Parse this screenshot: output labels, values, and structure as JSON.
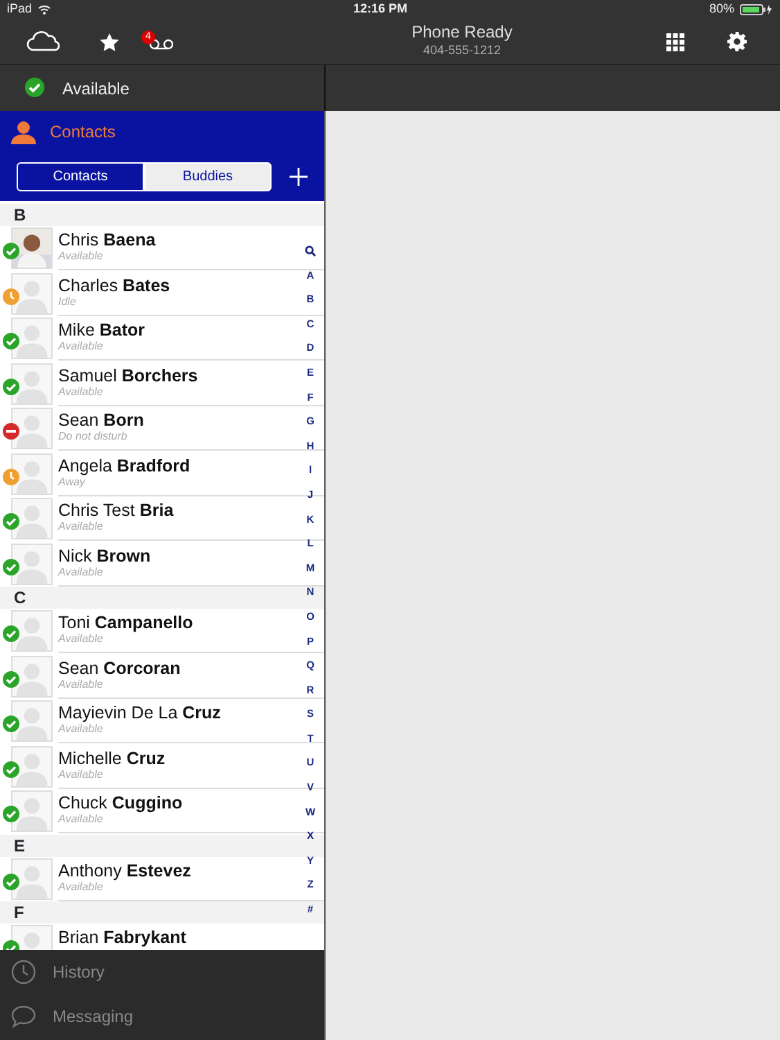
{
  "status_bar": {
    "carrier": "iPad",
    "time": "12:16 PM",
    "battery": "80%"
  },
  "toolbar": {
    "title": "Phone Ready",
    "number": "404-555-1212",
    "voicemail_badge": "4"
  },
  "presence": {
    "label": "Available",
    "kind": "available"
  },
  "contacts_header": {
    "title": "Contacts"
  },
  "segments": [
    {
      "label": "Contacts",
      "selected": true
    },
    {
      "label": "Buddies",
      "selected": false
    }
  ],
  "sections": [
    {
      "letter": "B",
      "contacts": [
        {
          "name": "Chris **Baena**",
          "status_text": "Available",
          "kind": "available",
          "has_photo": true
        },
        {
          "name": "Charles **Bates**",
          "status_text": "Idle",
          "kind": "away",
          "has_photo": false
        },
        {
          "name": "Mike **Bator**",
          "status_text": "Available",
          "kind": "available",
          "has_photo": false
        },
        {
          "name": "Samuel **Borchers**",
          "status_text": "Available",
          "kind": "available",
          "has_photo": false
        },
        {
          "name": "Sean **Born**",
          "status_text": "Do not disturb",
          "kind": "dnd",
          "has_photo": false
        },
        {
          "name": "Angela **Bradford**",
          "status_text": "Away",
          "kind": "away",
          "has_photo": false
        },
        {
          "name": "Chris Test **Bria**",
          "status_text": "Available",
          "kind": "available",
          "has_photo": false
        },
        {
          "name": "Nick **Brown**",
          "status_text": "Available",
          "kind": "available",
          "has_photo": false
        }
      ]
    },
    {
      "letter": "C",
      "contacts": [
        {
          "name": "Toni **Campanello**",
          "status_text": "Available",
          "kind": "available",
          "has_photo": false
        },
        {
          "name": "Sean **Corcoran**",
          "status_text": "Available",
          "kind": "available",
          "has_photo": false
        },
        {
          "name": "Mayievin De La **Cruz**",
          "status_text": "Available",
          "kind": "available",
          "has_photo": false
        },
        {
          "name": "Michelle **Cruz**",
          "status_text": "Available",
          "kind": "available",
          "has_photo": false
        },
        {
          "name": "Chuck **Cuggino**",
          "status_text": "Available",
          "kind": "available",
          "has_photo": false
        }
      ]
    },
    {
      "letter": "E",
      "contacts": [
        {
          "name": "Anthony **Estevez**",
          "status_text": "Available",
          "kind": "available",
          "has_photo": false
        }
      ]
    },
    {
      "letter": "F",
      "contacts": [
        {
          "name": "Brian **Fabrykant**",
          "kind": "available",
          "has_photo": false
        }
      ]
    }
  ],
  "index": [
    "A",
    "B",
    "C",
    "D",
    "E",
    "F",
    "G",
    "H",
    "I",
    "J",
    "K",
    "L",
    "M",
    "N",
    "O",
    "P",
    "Q",
    "R",
    "S",
    "T",
    "U",
    "V",
    "W",
    "X",
    "Y",
    "Z",
    "#"
  ],
  "bottom_nav": [
    {
      "label": "History",
      "kind": "history"
    },
    {
      "label": "Messaging",
      "kind": "messaging"
    }
  ]
}
